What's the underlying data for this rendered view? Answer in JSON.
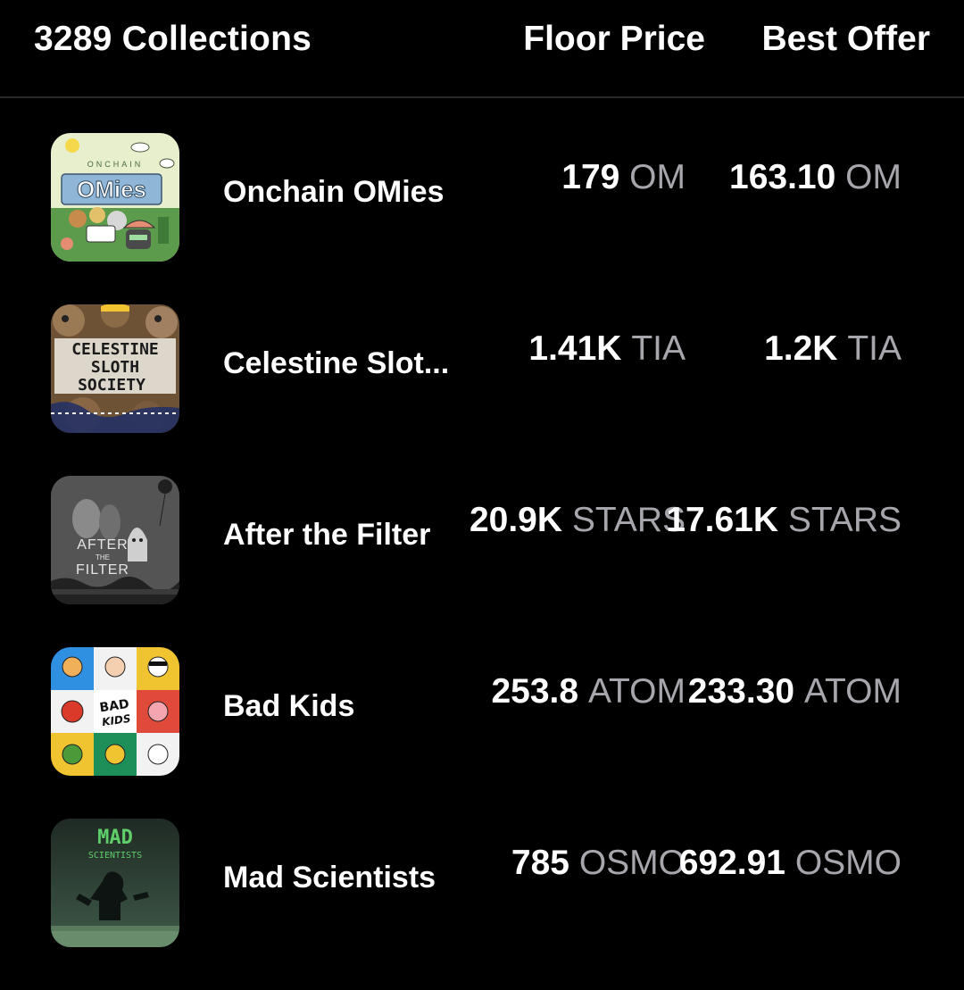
{
  "header": {
    "collections_count": "3289 Collections",
    "floor_price_label": "Floor Price",
    "best_offer_label": "Best Offer"
  },
  "collections": [
    {
      "name": "Onchain OMies",
      "floor_amount": "179",
      "floor_unit": "OM",
      "offer_amount": "163.10",
      "offer_unit": "OM",
      "thumb_text": "OMies",
      "thumb_arc_text": "ONCHAIN"
    },
    {
      "name": "Celestine Slot...",
      "floor_amount": "1.41K",
      "floor_unit": "TIA",
      "offer_amount": "1.2K",
      "offer_unit": "TIA",
      "thumb_line1": "CELESTINE",
      "thumb_line2": "SLOTH",
      "thumb_line3": "SOCIETY"
    },
    {
      "name": "After the Filter",
      "floor_amount": "20.9K",
      "floor_unit": "STARS",
      "offer_amount": "17.61K",
      "offer_unit": "STARS",
      "thumb_line1": "AFTER",
      "thumb_line2": "THE",
      "thumb_line3": "FILTER"
    },
    {
      "name": "Bad Kids",
      "floor_amount": "253.8",
      "floor_unit": "ATOM",
      "offer_amount": "233.30",
      "offer_unit": "ATOM",
      "thumb_line1": "BAD",
      "thumb_line2": "KIDS"
    },
    {
      "name": "Mad Scientists",
      "floor_amount": "785",
      "floor_unit": "OSMO",
      "offer_amount": "692.91",
      "offer_unit": "OSMO",
      "thumb_line1": "MAD",
      "thumb_line2": "SCIENTISTS"
    }
  ],
  "colors": {
    "background": "#000000",
    "text_primary": "#ffffff",
    "text_unit": "#a6a6ad",
    "divider": "#2a2a2a"
  }
}
